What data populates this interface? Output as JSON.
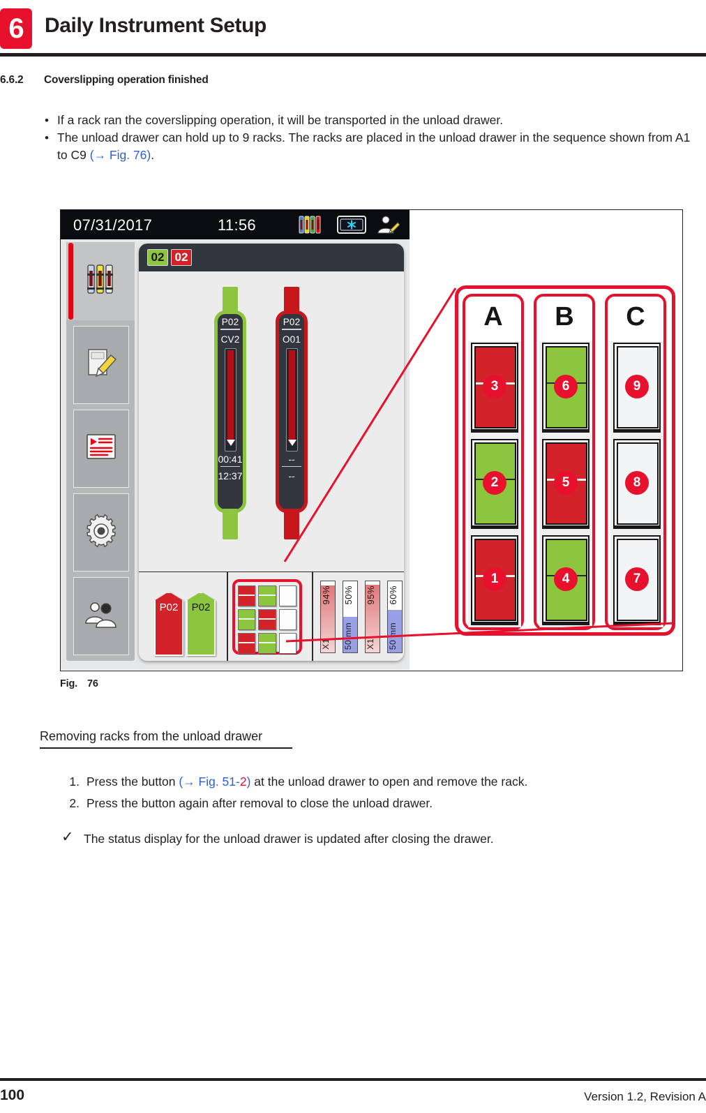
{
  "header": {
    "chapter_number": "6",
    "chapter_title": "Daily Instrument Setup"
  },
  "section": {
    "number": "6.6.2",
    "title": "Coverslipping operation finished"
  },
  "intro_bullets": [
    {
      "marker": "•",
      "text": "If a rack ran the coverslipping operation, it will be transported in the unload drawer."
    },
    {
      "marker": "•",
      "text_before": "The unload drawer can hold up to 9 racks. The racks are placed in the unload drawer in the sequence shown from A1 to C9 ",
      "link": "(→ Fig.  76)",
      "text_after": "."
    }
  ],
  "figure": {
    "caption_label": "Fig.",
    "caption_number": "76",
    "screen": {
      "status_bar": {
        "date": "07/31/2017",
        "time": "11:56",
        "icons": [
          "reagent-bottles-icon",
          "cooling-module-icon",
          "user-edit-icon"
        ]
      },
      "sidebar_items": [
        {
          "name": "sidebar-item-status-overview",
          "icon": "reagent-vessels-icon",
          "active": true
        },
        {
          "name": "sidebar-item-module-status",
          "icon": "slide-marker-icon",
          "active": false
        },
        {
          "name": "sidebar-item-program-list",
          "icon": "program-list-icon",
          "active": false
        },
        {
          "name": "sidebar-item-settings",
          "icon": "gear-icon",
          "active": false
        },
        {
          "name": "sidebar-item-user-settings",
          "icon": "user-supervisor-icon",
          "active": false
        }
      ],
      "panel": {
        "badge_green": "02",
        "badge_red": "02",
        "stations": [
          {
            "name": "station-cv2",
            "program": "P02",
            "station_id": "CV2",
            "color": "green",
            "accent": "#8cc63e",
            "time_remaining": "00:41",
            "time_total": "12:37",
            "fill_percent": 92
          },
          {
            "name": "station-o01",
            "program": "P02",
            "station_id": "O01",
            "color": "red",
            "accent": "#c8161d",
            "time_remaining": "--",
            "time_total": "--",
            "fill_percent": 92
          }
        ],
        "load_flags": [
          {
            "label": "P02",
            "color": "red"
          },
          {
            "label": "P02",
            "color": "green"
          }
        ],
        "unload_drawer_grid": [
          [
            "red",
            "green",
            "empty"
          ],
          [
            "green",
            "red",
            "empty"
          ],
          [
            "red",
            "green",
            "empty"
          ]
        ],
        "consumable_bars": [
          {
            "name": "coverslip-magazine-1",
            "percent_label": "94%",
            "unit_label": "X1",
            "fill_percent": 94,
            "fill_color": "#e79a9a"
          },
          {
            "name": "coverslip-length-1",
            "percent_label": "50%",
            "unit_label": "50 mm",
            "fill_percent": 50,
            "fill_color": "#9aa0e8"
          },
          {
            "name": "coverslip-magazine-2",
            "percent_label": "95%",
            "unit_label": "X1",
            "fill_percent": 95,
            "fill_color": "#e79a9a"
          },
          {
            "name": "coverslip-length-2",
            "percent_label": "60%",
            "unit_label": "50 mm",
            "fill_percent": 60,
            "fill_color": "#9aa0e8"
          }
        ]
      }
    },
    "callout": {
      "columns": [
        {
          "letter": "A",
          "slots": [
            {
              "position": "top",
              "state": "red",
              "number": "3"
            },
            {
              "position": "middle",
              "state": "green",
              "number": "2"
            },
            {
              "position": "bottom",
              "state": "red",
              "number": "1"
            }
          ]
        },
        {
          "letter": "B",
          "slots": [
            {
              "position": "top",
              "state": "green",
              "number": "6"
            },
            {
              "position": "middle",
              "state": "red",
              "number": "5"
            },
            {
              "position": "bottom",
              "state": "green",
              "number": "4"
            }
          ]
        },
        {
          "letter": "C",
          "slots": [
            {
              "position": "top",
              "state": "empty",
              "number": "9"
            },
            {
              "position": "middle",
              "state": "empty",
              "number": "8"
            },
            {
              "position": "bottom",
              "state": "empty",
              "number": "7"
            }
          ]
        }
      ]
    }
  },
  "sub_heading": "Removing racks from the unload drawer",
  "steps": [
    {
      "index": "1.",
      "text_before": "Press the button ",
      "link_blue": "(→ Fig.  51-",
      "link_red": "2",
      "link_blue_end": ")",
      "text_after": " at the unload drawer to open and remove the rack."
    },
    {
      "index": "2.",
      "text_before": "Press the button again after removal to close the unload drawer.",
      "link_blue": "",
      "link_red": "",
      "link_blue_end": "",
      "text_after": ""
    }
  ],
  "result": {
    "marker": "✓",
    "text": "The status display for the unload drawer is updated after closing the drawer."
  },
  "footer": {
    "page_number": "100",
    "version": "Version 1.2, Revision A"
  },
  "colors": {
    "brand_red": "#e8112d",
    "status_green": "#8cc63e",
    "status_red": "#d2232a",
    "link_blue": "#2f5fd0",
    "panel_dark": "#32363f"
  }
}
